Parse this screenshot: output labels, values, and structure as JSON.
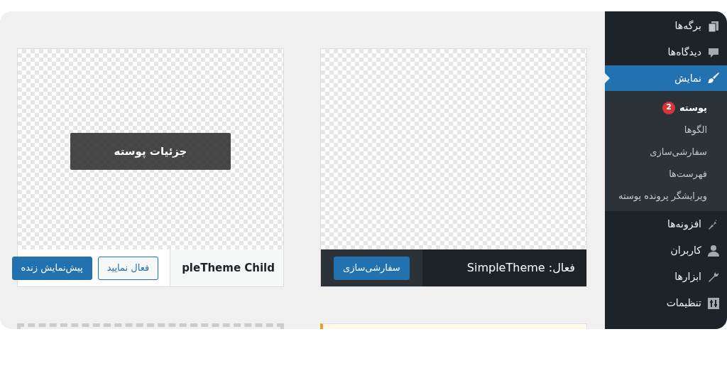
{
  "sidebar": {
    "items": [
      {
        "label": "برگه‌ها",
        "selected": false
      },
      {
        "label": "دیدگاه‌ها",
        "selected": false
      },
      {
        "label": "نمایش",
        "selected": true,
        "children": [
          {
            "label": "پوسته",
            "badge": "2",
            "selected": true
          },
          {
            "label": "الگوها",
            "selected": false
          },
          {
            "label": "سفارشی‌سازی",
            "selected": false
          },
          {
            "label": "فهرست‌ها",
            "selected": false
          },
          {
            "label": "ویرایشگر پرونده پوسته",
            "selected": false
          }
        ]
      },
      {
        "label": "افزونه‌ها",
        "selected": false
      },
      {
        "label": "کاربران",
        "selected": false
      },
      {
        "label": "ابزارها",
        "selected": false
      },
      {
        "label": "تنظیمات",
        "selected": false
      }
    ]
  },
  "themes": [
    {
      "active": true,
      "status_label": "فعال:",
      "name": "SimpleTheme",
      "buttons": [
        {
          "label": "سفارشی‌سازی",
          "kind": "primary"
        }
      ]
    },
    {
      "active": false,
      "name": "pleTheme Child",
      "details_label": "جزئیات پوسته",
      "buttons": [
        {
          "label": "فعال نمایید",
          "kind": "secondary"
        },
        {
          "label": "پیش‌نمایش زنده",
          "kind": "primary"
        }
      ]
    }
  ]
}
